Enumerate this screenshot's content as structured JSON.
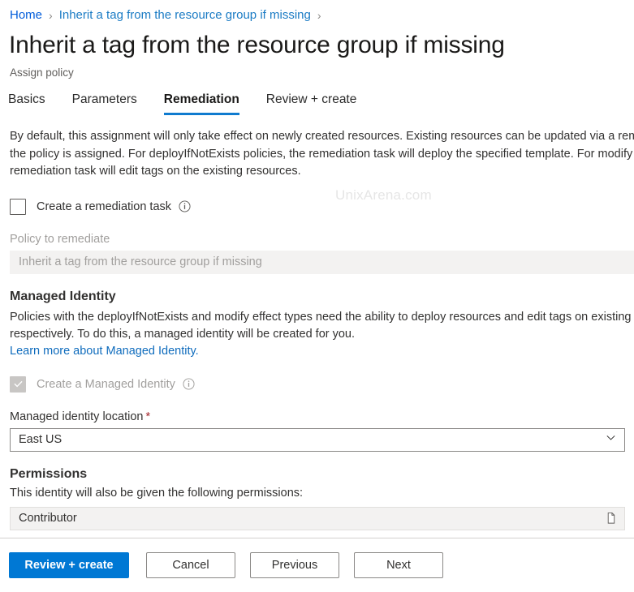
{
  "breadcrumb": {
    "home": "Home",
    "separator": "›",
    "current": "Inherit a tag from the resource group if missing"
  },
  "header": {
    "title": "Inherit a tag from the resource group if missing",
    "subtitle": "Assign policy"
  },
  "tabs": [
    {
      "label": "Basics",
      "active": false
    },
    {
      "label": "Parameters",
      "active": false
    },
    {
      "label": "Remediation",
      "active": true
    },
    {
      "label": "Review + create",
      "active": false
    }
  ],
  "remediation": {
    "intro": "By default, this assignment will only take effect on newly created resources. Existing resources can be updated via a remediation task after the policy is assigned. For deployIfNotExists policies, the remediation task will deploy the specified template. For modify policies, the remediation task will edit tags on the existing resources.",
    "create_task_label": "Create a remediation task",
    "create_task_checked": false,
    "info_icon": "info-icon",
    "policy_to_remediate_label": "Policy to remediate",
    "policy_to_remediate_value": "Inherit a tag from the resource group if missing"
  },
  "managed_identity": {
    "heading": "Managed Identity",
    "description": "Policies with the deployIfNotExists and modify effect types need the ability to deploy resources and edit tags on existing resources respectively. To do this, a managed identity will be created for you.",
    "learn_more": "Learn more about Managed Identity.",
    "create_identity_label": "Create a Managed Identity",
    "create_identity_checked": true,
    "location_label": "Managed identity location",
    "required_marker": "*",
    "location_value": "East US",
    "chevron_icon": "chevron-down-icon"
  },
  "permissions": {
    "heading": "Permissions",
    "description": "This identity will also be given the following permissions:",
    "role": "Contributor",
    "copy_icon": "copy-icon"
  },
  "footer": {
    "review_create": "Review + create",
    "cancel": "Cancel",
    "previous": "Previous",
    "next": "Next"
  },
  "watermark": "UnixArena.com",
  "colors": {
    "accent": "#0078d4",
    "link": "#0f6cbd",
    "required": "#a4262c",
    "disabled_bg": "#f3f2f1"
  }
}
